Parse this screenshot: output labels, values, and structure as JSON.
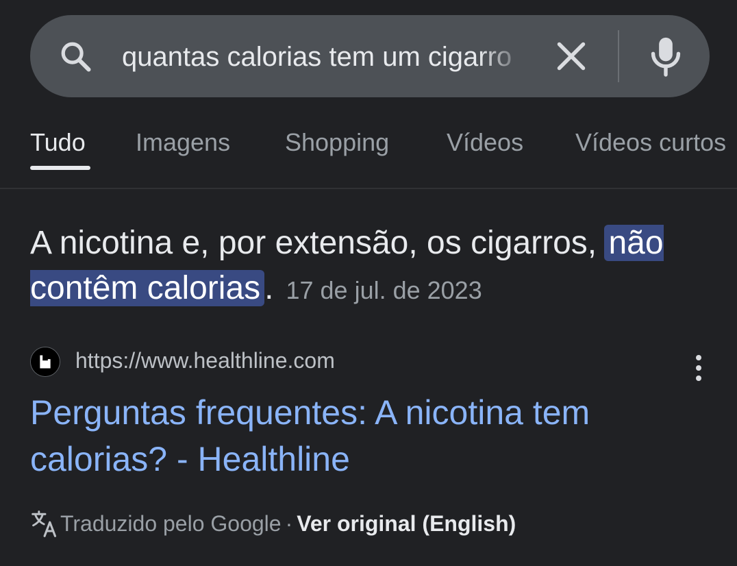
{
  "search": {
    "query": "quantas calorias tem um cigarro",
    "search_icon": "search-icon",
    "clear_icon": "close-icon",
    "mic_icon": "mic-icon"
  },
  "tabs": [
    {
      "label": "Tudo",
      "active": true
    },
    {
      "label": "Imagens",
      "active": false
    },
    {
      "label": "Shopping",
      "active": false
    },
    {
      "label": "Vídeos",
      "active": false
    },
    {
      "label": "Vídeos curtos",
      "active": false
    }
  ],
  "snippet": {
    "text_before": "A nicotina e, por extensão, os cigarros, ",
    "highlight": "não contêm calorias",
    "text_after": ".",
    "date": "17 de jul. de 2023"
  },
  "result": {
    "favicon_icon": "healthline-logo-icon",
    "url": "https://www.healthline.com",
    "more_icon": "more-vert-icon",
    "title": "Perguntas frequentes: A nicotina tem calorias? - Healthline"
  },
  "translation": {
    "icon": "translate-icon",
    "translated_by": "Traduzido pelo Google",
    "separator": "·",
    "view_original": "Ver original (English)"
  },
  "colors": {
    "background": "#202124",
    "search_bar": "#4d5156",
    "link": "#8ab4f8",
    "highlight": "#394a82",
    "muted_text": "#9aa0a6"
  }
}
